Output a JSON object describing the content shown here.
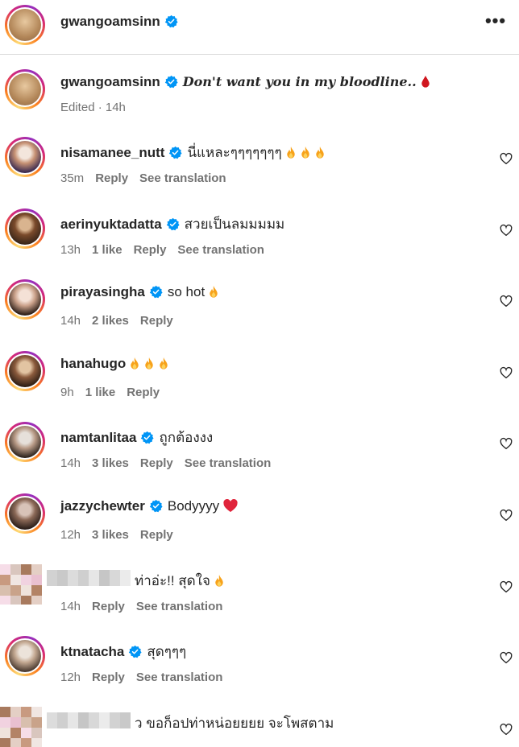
{
  "header": {
    "username": "gwangoamsinn",
    "more_icon": "more-horizontal-icon"
  },
  "caption": {
    "username": "gwangoamsinn",
    "text": "Don't want you in my bloodline..",
    "emoji": "blood-drop-icon",
    "meta": "Edited · 14h"
  },
  "labels": {
    "reply": "Reply",
    "see_translation": "See translation"
  },
  "comments": [
    {
      "username": "nisamanee_nutt",
      "text": "นี่แหละๆๆๆๆๆๆๆ",
      "emoji_count": 3,
      "time": "35m",
      "likes": "",
      "translation": true
    },
    {
      "username": "aerinyuktadatta",
      "text": "สวยเป็นลมมมมม",
      "emoji_count": 0,
      "time": "13h",
      "likes": "1 like",
      "translation": true
    },
    {
      "username": "pirayasingha",
      "text": "so hot",
      "emoji_count": 1,
      "time": "14h",
      "likes": "2 likes",
      "translation": false
    },
    {
      "username": "hanahugo",
      "text": "",
      "emoji_count": 3,
      "time": "9h",
      "likes": "1 like",
      "translation": false
    },
    {
      "username": "namtanlitaa",
      "text": "ถูกต้องงง",
      "emoji_count": 0,
      "time": "14h",
      "likes": "3 likes",
      "translation": true
    },
    {
      "username": "jazzychewter",
      "text": "Bodyyyy",
      "emoji": "red-heart-icon",
      "time": "12h",
      "likes": "3 likes",
      "translation": false
    },
    {
      "username": "",
      "text": "ท่าอ่ะ!! สุดใจ",
      "emoji_count": 1,
      "time": "14h",
      "likes": "",
      "translation": true,
      "blurred": true
    },
    {
      "username": "ktnatacha",
      "text": "สุดๆๆๆ",
      "emoji_count": 0,
      "time": "12h",
      "likes": "",
      "translation": true
    },
    {
      "username": "",
      "text": "ว ขอก็อปท่าหน่อยยยย จะโพสตาม",
      "emoji_count": 0,
      "time": "",
      "likes": "",
      "translation": false,
      "blurred": true
    }
  ],
  "colors": {
    "verified": "#0095f6",
    "muted": "#737373",
    "text": "#262626",
    "fire": "#f7a21b",
    "heart_red": "#e0243b"
  }
}
